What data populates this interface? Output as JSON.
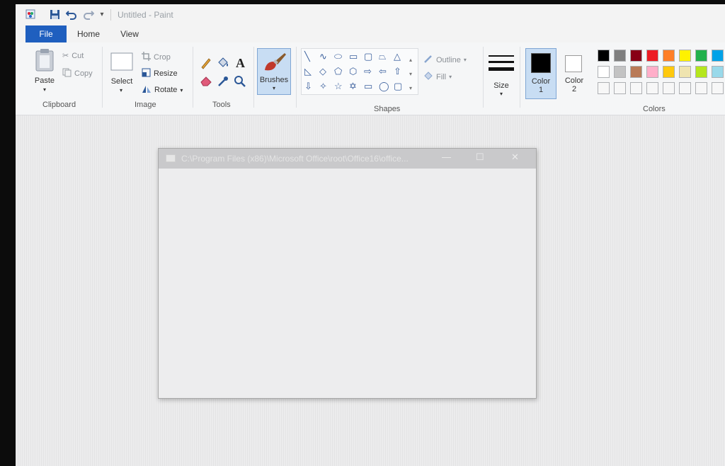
{
  "window": {
    "title": "Untitled - Paint"
  },
  "quick_access": {
    "customize_glyph": "▾"
  },
  "tabs": [
    {
      "label": "File"
    },
    {
      "label": "Home"
    },
    {
      "label": "View"
    }
  ],
  "clipboard": {
    "paste": "Paste",
    "cut": "Cut",
    "copy": "Copy",
    "group": "Clipboard"
  },
  "image": {
    "select": "Select",
    "crop": "Crop",
    "resize": "Resize",
    "rotate": "Rotate",
    "group": "Image"
  },
  "tools": {
    "group": "Tools",
    "text_glyph": "A"
  },
  "brushes": {
    "label": "Brushes"
  },
  "shapes": {
    "outline": "Outline",
    "fill": "Fill",
    "group": "Shapes"
  },
  "size": {
    "label": "Size"
  },
  "color1": {
    "label": "Color",
    "number": "1",
    "value": "#000000"
  },
  "color2": {
    "label": "Color",
    "number": "2",
    "value": "#ffffff"
  },
  "colors": {
    "group": "Colors",
    "row1": [
      "#000000",
      "#7f7f7f",
      "#880015",
      "#ed1c24",
      "#ff7f27",
      "#fff200",
      "#22b14c",
      "#00a2e8"
    ],
    "row2": [
      "#ffffff",
      "#c3c3c3",
      "#b97a57",
      "#ffaec9",
      "#ffc90e",
      "#efe4b0",
      "#b5e61d",
      "#99d9ea"
    ]
  },
  "dialog": {
    "title": "C:\\Program Files (x86)\\Microsoft Office\\root\\Office16\\office...",
    "minimize": "—",
    "maximize": "☐",
    "close": "✕"
  }
}
